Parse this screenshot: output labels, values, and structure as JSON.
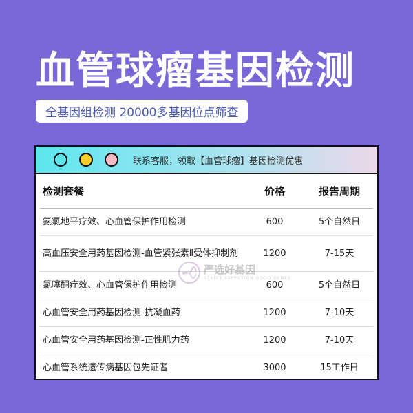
{
  "header": {
    "title": "血管球瘤基因检测",
    "subtitle": "全基因组检测 20000多基因位点筛查"
  },
  "card": {
    "notice": "联系客服，领取【血管球瘤】基因检测优惠",
    "dot_colors": [
      "#5ce6ee",
      "#f5cc2a",
      "#f6bcc6"
    ]
  },
  "table": {
    "headers": {
      "name": "检测套餐",
      "price": "价格",
      "period": "报告周期"
    },
    "rows": [
      {
        "name": "氨氯地平疗效、心血管保护作用检测",
        "price": "600",
        "period": "5个自然日"
      },
      {
        "name": "高血压安全用药基因检测-血管紧张素Ⅱ受体抑制剂",
        "price": "1200",
        "period": "7-15天"
      },
      {
        "name": "氯噻酮疗效、心血管保护作用检测",
        "price": "600",
        "period": "5个自然日"
      },
      {
        "name": "心血管安全用药基因检测-抗凝血药",
        "price": "1200",
        "period": "7-10天"
      },
      {
        "name": "心血管安全用药基因检测-正性肌力药",
        "price": "1200",
        "period": "7-10天"
      },
      {
        "name": "心血管系统遗传病基因包先证者",
        "price": "3000",
        "period": "15工作日"
      }
    ]
  },
  "watermark": {
    "text": "严选好基因",
    "sub": "STRICT SELECTION GOOD GENES"
  },
  "colors": {
    "background": "#7b68d8",
    "accent": "#5ce6ee"
  }
}
